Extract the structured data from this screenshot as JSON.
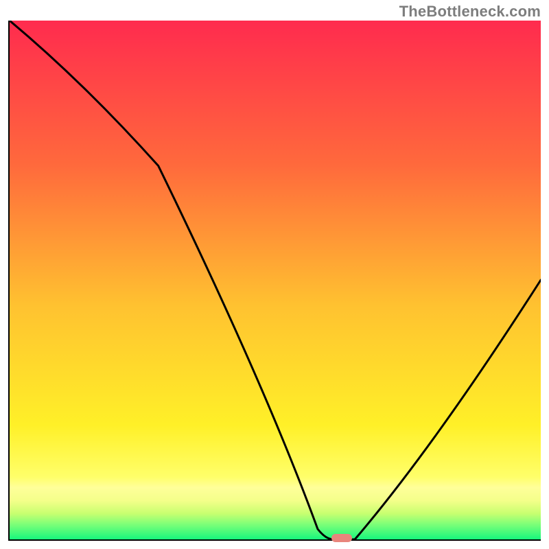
{
  "attribution": "TheBottleneck.com",
  "colors": {
    "gradient_top": "#ff2b4e",
    "gradient_mid_upper": "#ff8a3a",
    "gradient_mid_lower": "#fff028",
    "band_yellow": "#ffff9a",
    "band_yellow_green": "#d8ff74",
    "gradient_bottom": "#17f77d",
    "marker": "#e8857c",
    "curve": "#000000"
  },
  "chart_data": {
    "type": "line",
    "title": "",
    "xlabel": "",
    "ylabel": "",
    "xlim": [
      0,
      100
    ],
    "ylim": [
      0,
      100
    ],
    "x": [
      0,
      28,
      58,
      61,
      65,
      100
    ],
    "values": [
      100,
      72,
      2,
      0,
      0,
      50
    ],
    "optimum_marker": {
      "x_pct": 62.5,
      "y_pct": 0
    }
  }
}
